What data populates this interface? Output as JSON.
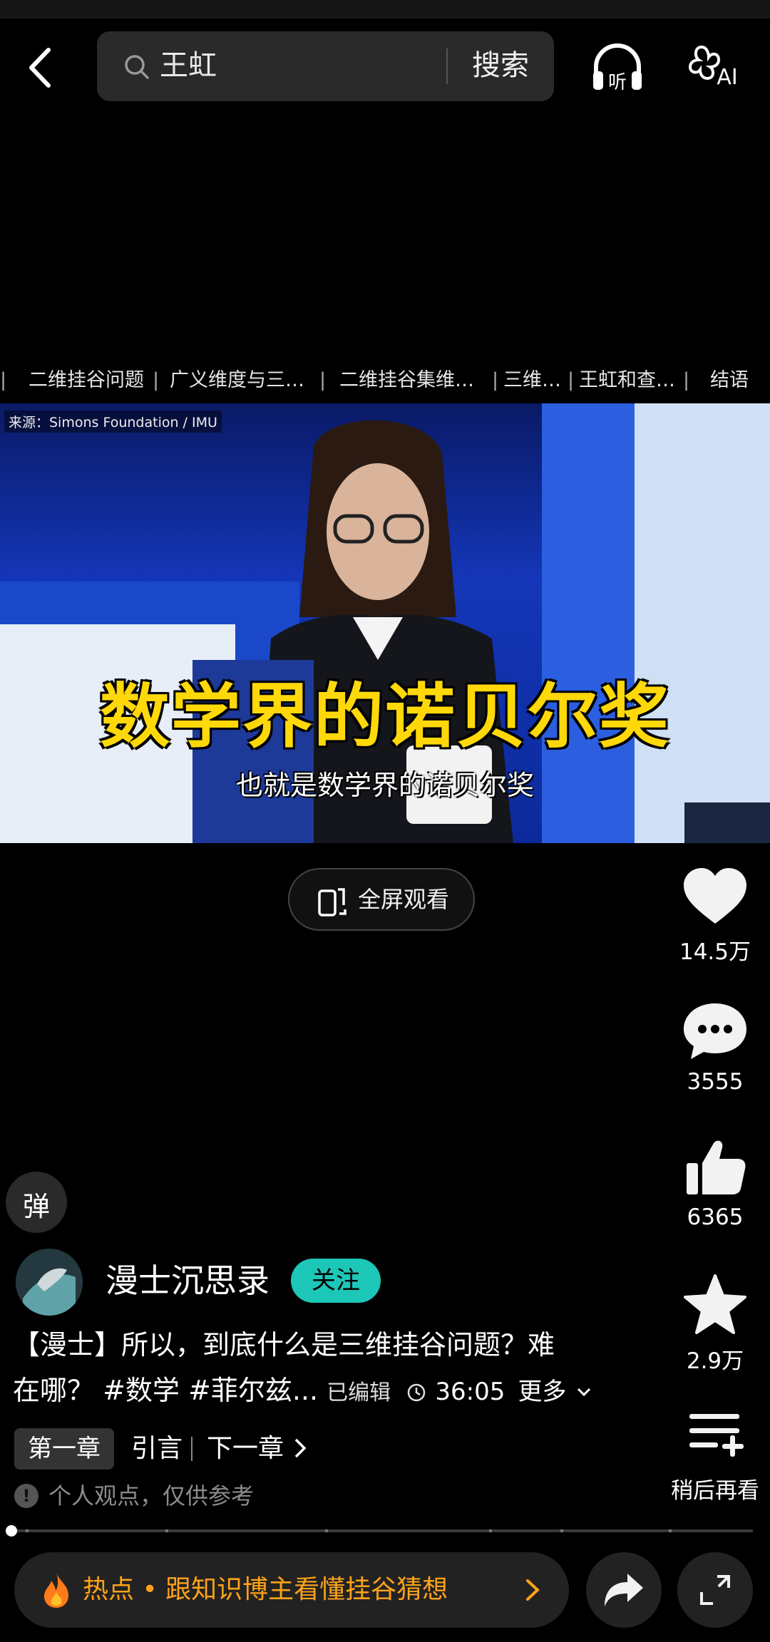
{
  "search": {
    "query": "王虹",
    "button": "搜索"
  },
  "chapters": [
    {
      "label": "二维挂谷问题"
    },
    {
      "label": "广义维度与三…"
    },
    {
      "label": "二维挂谷集维…"
    },
    {
      "label": "三维…"
    },
    {
      "label": "王虹和查…"
    },
    {
      "label": "结语"
    }
  ],
  "video": {
    "source": "来源：Simons Foundation / IMU",
    "caption_big": "数学界的诺贝尔奖",
    "caption_small": "也就是数学界的诺贝尔奖"
  },
  "fullscreen": {
    "label": "全屏观看"
  },
  "actions": {
    "likes": "14.5万",
    "comments": "3555",
    "thumbs": "6365",
    "favorites": "2.9万",
    "watch_later": "稍后再看"
  },
  "danmaku": {
    "label": "弹"
  },
  "author": {
    "name": "漫士沉思录",
    "follow": "关注"
  },
  "description": {
    "line1": "【漫士】所以，到底什么是三维挂谷问题？难",
    "line2": "在哪？ #数学 #菲尔兹...",
    "edited": "已编辑",
    "duration": "36:05",
    "more": "更多"
  },
  "chapter_nav": {
    "current": "第一章",
    "title": "引言",
    "next": "下一章"
  },
  "disclaimer": {
    "icon": "!",
    "text": "个人观点，仅供参考"
  },
  "progress": {
    "fraction": 0.002
  },
  "hot": {
    "text": "热点 • 跟知识博主看懂挂谷猜想"
  },
  "colors": {
    "accent": "#1cc7b8",
    "hot": "#ffa31a",
    "caption": "#ffd80a"
  }
}
